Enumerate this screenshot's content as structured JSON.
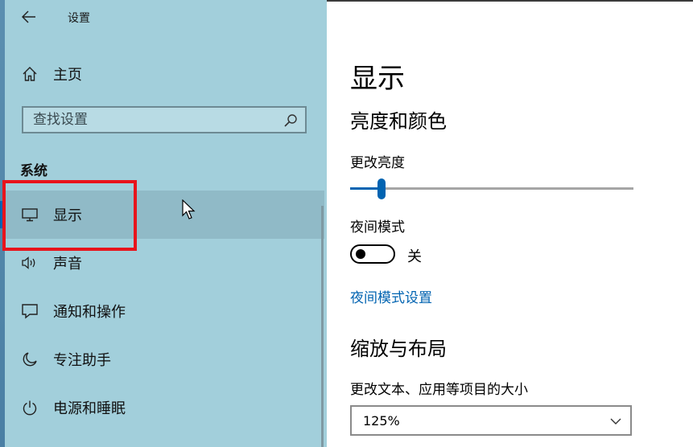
{
  "window": {
    "title": "设置",
    "back_icon": "back-arrow-icon"
  },
  "sidebar": {
    "home_label": "主页",
    "search_placeholder": "查找设置",
    "section_label": "系统",
    "items": [
      {
        "label": "显示",
        "icon": "monitor-icon",
        "selected": true
      },
      {
        "label": "声音",
        "icon": "speaker-icon",
        "selected": false
      },
      {
        "label": "通知和操作",
        "icon": "notification-icon",
        "selected": false
      },
      {
        "label": "专注助手",
        "icon": "moon-icon",
        "selected": false
      },
      {
        "label": "电源和睡眠",
        "icon": "power-icon",
        "selected": false
      }
    ]
  },
  "main": {
    "page_title": "显示",
    "brightness_section": "亮度和颜色",
    "brightness_label": "更改亮度",
    "brightness_value": 0.11,
    "night_mode_label": "夜间模式",
    "night_mode_state": "关",
    "night_mode_link": "夜间模式设置",
    "scale_section": "缩放与布局",
    "scale_label": "更改文本、应用等项目的大小",
    "scale_value": "125%"
  },
  "colors": {
    "accent": "#0063b1",
    "sidebar_bg": "#a2cfdb",
    "highlight": "#e8141c"
  }
}
